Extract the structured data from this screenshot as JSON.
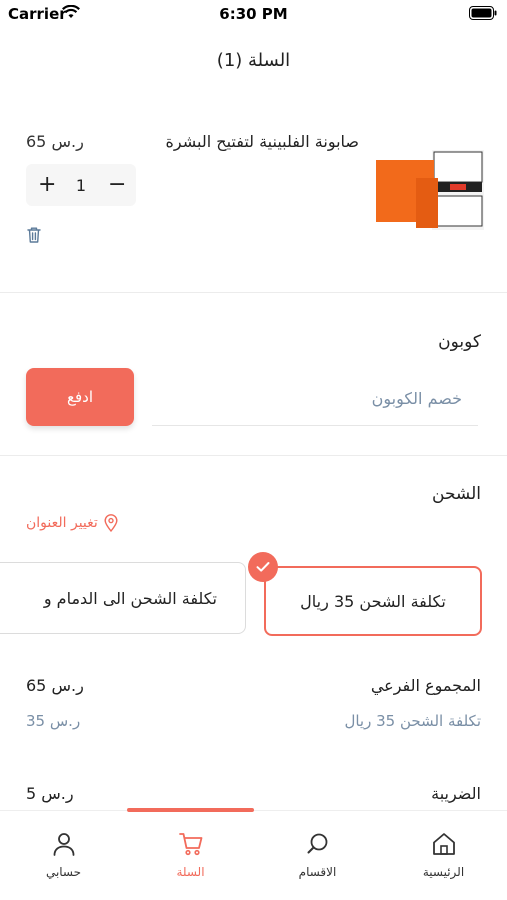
{
  "status_bar": {
    "carrier": "Carrier",
    "time": "6:30 PM"
  },
  "header": {
    "title": "السلة (1)"
  },
  "cart": {
    "items": [
      {
        "name": "صابونة الفلبينية لتفتيح البشرة",
        "price": "ر.س 65",
        "quantity": "1",
        "image_icon": "product-soap-image"
      }
    ]
  },
  "coupon": {
    "title": "كوبون",
    "placeholder": "خصم الكوبون",
    "pay_label": "ادفع"
  },
  "shipping": {
    "title": "الشحن",
    "change_address_label": "تغيير العنوان",
    "options": [
      {
        "label": "تكلفة الشحن 35 ريال",
        "selected": true
      },
      {
        "label": "تكلفة الشحن الى الدمام و",
        "selected": false
      }
    ]
  },
  "summary": {
    "subtotal_label": "المجموع الفرعي",
    "subtotal_value": "ر.س 65",
    "shipping_label": "تكلفة الشحن 35 ريال",
    "shipping_value": "ر.س 35",
    "tax_label": "الضريبة",
    "tax_value": "ر.س 5"
  },
  "tab_bar": {
    "home": "الرئيسية",
    "categories": "الاقسام",
    "cart": "السلة",
    "account": "حسابي"
  },
  "colors": {
    "accent": "#f26b5b",
    "muted": "#7a8fa6"
  }
}
